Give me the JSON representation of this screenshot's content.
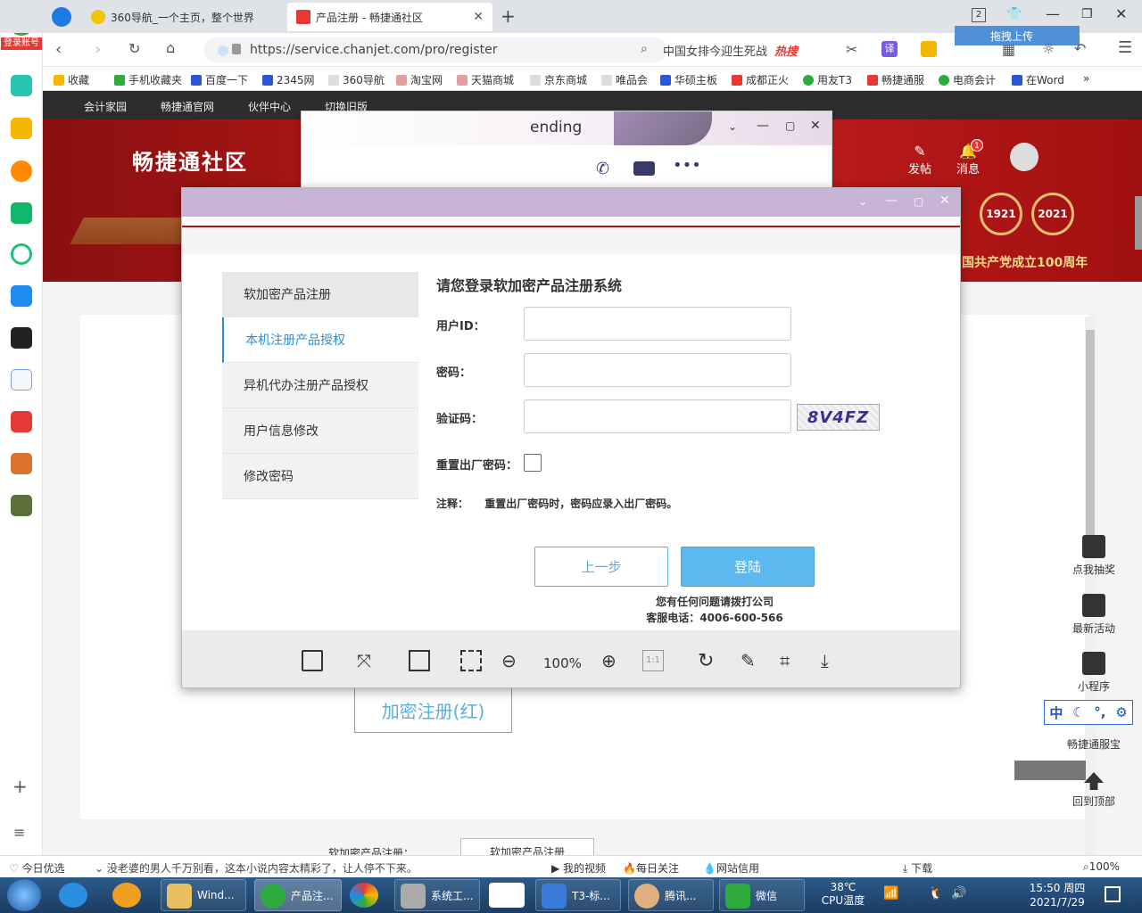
{
  "tabs": [
    {
      "label": "360导航_一个主页，整个世界"
    },
    {
      "label": "产品注册 - 畅捷通社区"
    }
  ],
  "address": {
    "url": "https://service.chanjet.com/pro/register",
    "search": "中国女排今迎生死战",
    "hot": "热搜",
    "upload": "拖拽上传",
    "tab_count": "2"
  },
  "sidebar": {
    "login": "登录账号"
  },
  "bookmarks": [
    "收藏",
    "手机收藏夹",
    "百度一下",
    "2345网",
    "360导航",
    "淘宝网",
    "天猫商城",
    "京东商城",
    "唯品会",
    "华硕主板",
    "成都正火",
    "用友T3",
    "畅捷通服",
    "电商会计",
    "在Word"
  ],
  "topnav": [
    "会计家园",
    "畅捷通官网",
    "伙伴中心",
    "切换旧版"
  ],
  "banner": {
    "title": "畅捷通社区",
    "post": "发帖",
    "msg": "消息",
    "badge": "1",
    "year1": "1921",
    "year2": "2021",
    "slogan": "国共产党成立100周年"
  },
  "chat": {
    "name": "ending"
  },
  "dialog": {
    "menu": [
      "软加密产品注册",
      "本机注册产品授权",
      "异机代办注册产品授权",
      "用户信息修改",
      "修改密码"
    ],
    "title": "请您登录软加密产品注册系统",
    "userid_label": "用户ID：",
    "pwd_label": "密码：",
    "captcha_label": "验证码：",
    "captcha": "8V4FZ",
    "reset_label": "重置出厂密码：",
    "note_label": "注释：",
    "note": "重置出厂密码时，密码应录入出厂密码。",
    "prev": "上一步",
    "login": "登陆",
    "contact1": "您有任何问题请拨打公司",
    "contact2": "客服电话：4006-600-566",
    "zoom": "100%"
  },
  "redbtn": "加密注册(红)",
  "floaters": [
    "点我抽奖",
    "最新活动",
    "小程序",
    "畅捷通服宝",
    "回到顶部"
  ],
  "ime": {
    "lang": "中"
  },
  "statusbar": {
    "left": "今日优选",
    "news": "没老婆的男人千万别看，这本小说内容太精彩了，让人停不下来。",
    "video": "我的视频",
    "focus": "每日关注",
    "credit": "网站信用",
    "download": "下载",
    "zoom": "100%"
  },
  "taskbar": {
    "items": [
      "Wind...",
      "产品注...",
      "系统工...",
      "T3-标...",
      "腾讯...",
      "微信"
    ],
    "temp": "38℃",
    "cpu": "CPU温度",
    "time": "15:50 周四",
    "date": "2021/7/29"
  },
  "bottom_text": {
    "left": "软加密产品注册：",
    "btn": "软加密产品注册"
  },
  "colors": {
    "accent": "#5cb8ee",
    "banner": "#b81818",
    "title": "#c8b4d4"
  }
}
